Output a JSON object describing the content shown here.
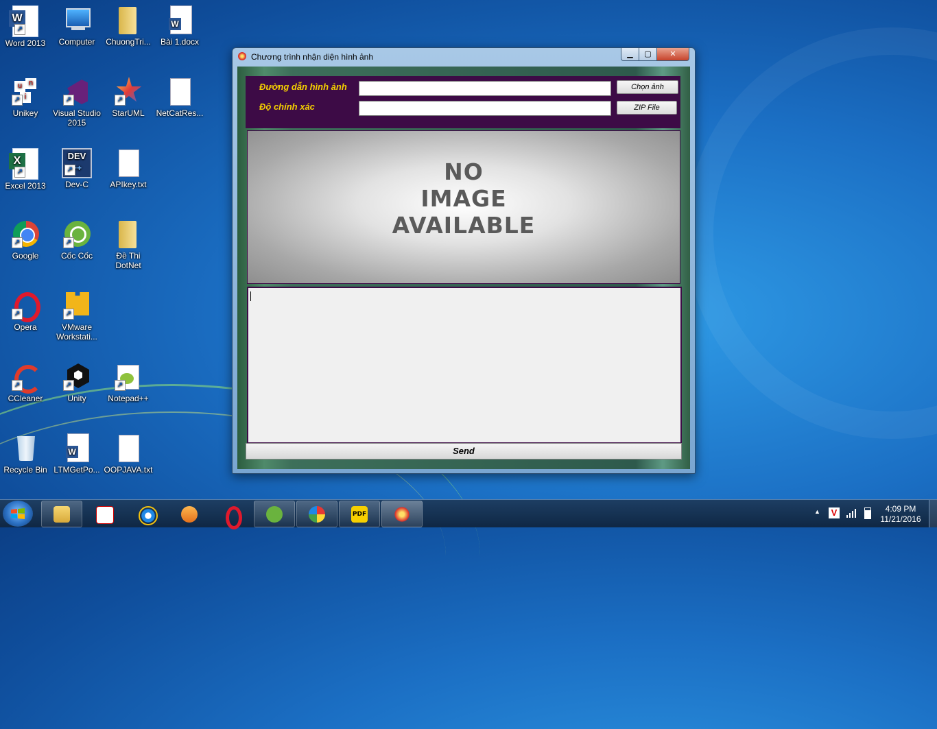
{
  "desktop": {
    "icons": [
      {
        "label": "Word 2013"
      },
      {
        "label": "Computer"
      },
      {
        "label": "ChuongTri..."
      },
      {
        "label": "Bài 1.docx"
      },
      {
        "label": "Unikey"
      },
      {
        "label": "Visual Studio 2015"
      },
      {
        "label": "StarUML"
      },
      {
        "label": "NetCatRes..."
      },
      {
        "label": "Excel 2013"
      },
      {
        "label": "Dev-C"
      },
      {
        "label": "APIkey.txt"
      },
      {
        "label": "Google"
      },
      {
        "label": "Cốc Cốc"
      },
      {
        "label": "Đề Thi DotNet"
      },
      {
        "label": "Opera"
      },
      {
        "label": "VMware Workstati..."
      },
      {
        "label": "CCleaner"
      },
      {
        "label": "Unity"
      },
      {
        "label": "Notepad++"
      },
      {
        "label": "Recycle Bin"
      },
      {
        "label": "LTMGetPo..."
      },
      {
        "label": "OOPJAVA.txt"
      }
    ]
  },
  "window": {
    "title": "Chương trình nhận diện hình ảnh",
    "controls": {
      "minimize": "▁",
      "maximize": "▢",
      "close": "✕"
    },
    "form": {
      "path_label": "Đường dẫn hình ảnh",
      "path_value": "",
      "choose_button": "Chọn ảnh",
      "accuracy_label": "Độ chính xác",
      "accuracy_value": "",
      "zip_button": "ZIP File"
    },
    "image_placeholder": {
      "line1": "NO",
      "line2": "IMAGE",
      "line3": "AVAILABLE"
    },
    "output_text": "",
    "send_button": "Send"
  },
  "taskbar": {
    "apps": [
      "file-explorer",
      "unikey",
      "internet-explorer",
      "media-player",
      "opera",
      "coc-coc",
      "paint",
      "pdf-reader",
      "image-recognition-app"
    ],
    "tray": {
      "vietnamese_ime": "V",
      "expand": "▲"
    },
    "clock": {
      "time": "4:09 PM",
      "date": "11/21/2016"
    }
  },
  "colors": {
    "form_band": "#3d0b46",
    "label_yellow": "#f5d000",
    "desktop_blue": "#1b6fc4"
  }
}
